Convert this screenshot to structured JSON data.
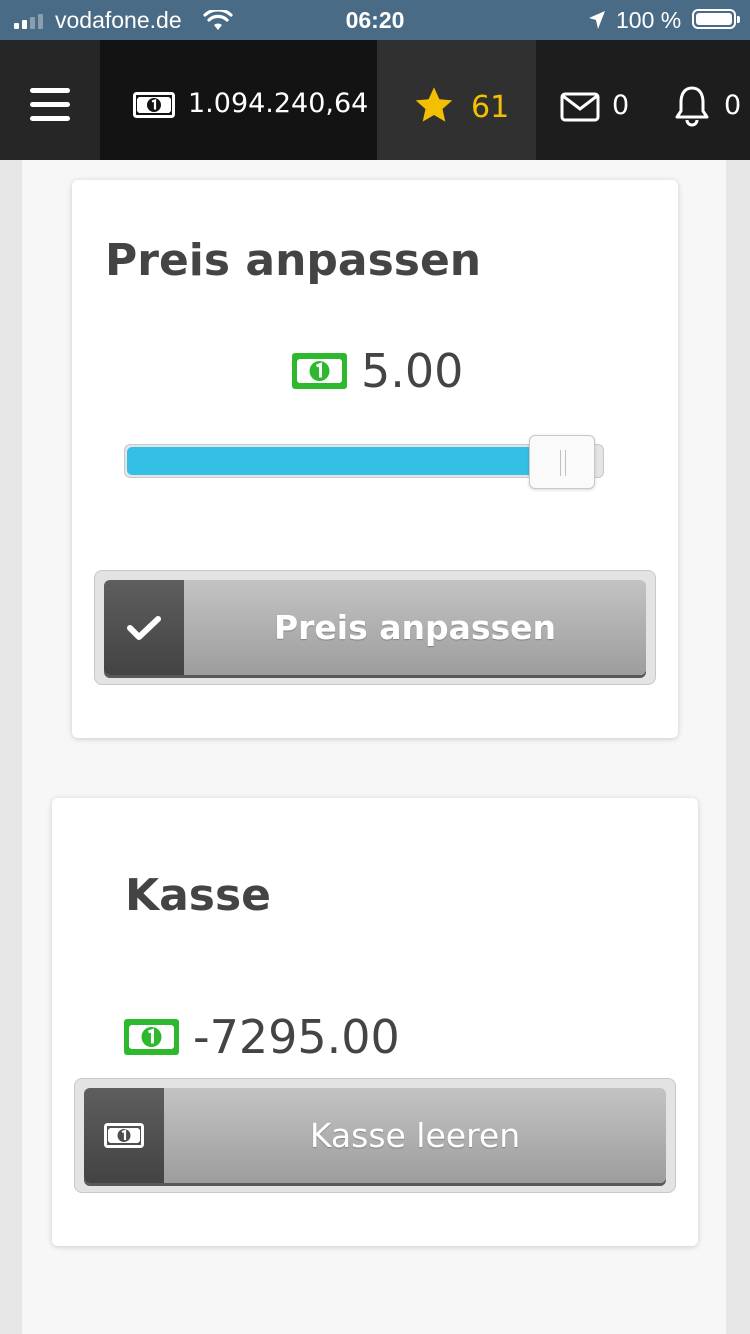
{
  "status_bar": {
    "carrier": "vodafone.de",
    "time": "06:20",
    "battery": "100 %"
  },
  "nav": {
    "money": "1.094.240,64",
    "stars": "61",
    "messages": "0",
    "notifications": "0"
  },
  "colors": {
    "accent_blue": "#33c0e4",
    "star_gold": "#f2c000",
    "money_green": "#2eb82e"
  },
  "price_card": {
    "title": "Preis anpassen",
    "price": "5.00",
    "slider_level": 0.88,
    "button_label": "Preis anpassen",
    "button_icon": "checkmark-icon"
  },
  "register_card": {
    "title": "Kasse",
    "balance": "-7295.00",
    "button_label": "Kasse leeren",
    "button_icon": "banknote-icon"
  }
}
